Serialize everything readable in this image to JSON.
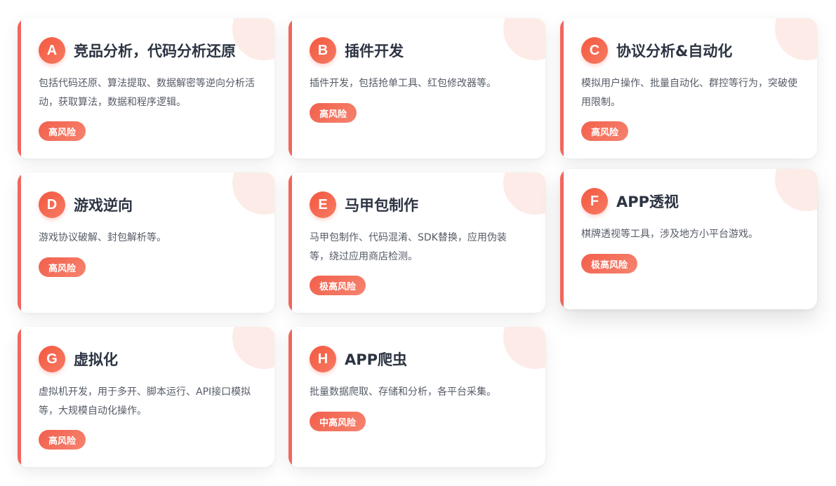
{
  "cards": [
    {
      "letter": "A",
      "title": "竞品分析，代码分析还原",
      "description": "包括代码还原、算法提取、数据解密等逆向分析活动，获取算法，数据和程序逻辑。",
      "risk": "高风险"
    },
    {
      "letter": "B",
      "title": "插件开发",
      "description": "插件开发，包括抢单工具、红包修改器等。",
      "risk": "高风险"
    },
    {
      "letter": "C",
      "title": "协议分析&自动化",
      "description": "模拟用户操作、批量自动化、群控等行为，突破使用限制。",
      "risk": "高风险"
    },
    {
      "letter": "D",
      "title": "游戏逆向",
      "description": "游戏协议破解、封包解析等。",
      "risk": "高风险"
    },
    {
      "letter": "E",
      "title": "马甲包制作",
      "description": "马甲包制作、代码混淆、SDK替换，应用伪装等，绕过应用商店检测。",
      "risk": "极高风险"
    },
    {
      "letter": "F",
      "title": "APP透视",
      "description": "棋牌透视等工具，涉及地方小平台游戏。",
      "risk": "极高风险"
    },
    {
      "letter": "G",
      "title": "虚拟化",
      "description": "虚拟机开发，用于多开、脚本运行、API接口模拟等，大规模自动化操作。",
      "risk": "高风险"
    },
    {
      "letter": "H",
      "title": "APP爬虫",
      "description": "批量数据爬取、存储和分析，各平台采集。",
      "risk": "中高风险"
    }
  ],
  "colors": {
    "accent": "#f2665d",
    "title": "#2c3442",
    "text": "#555b66",
    "blob": "#fdebe7"
  }
}
